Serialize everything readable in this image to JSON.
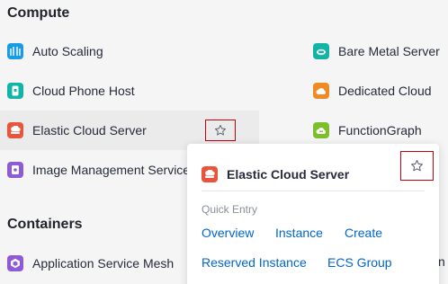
{
  "sections": {
    "compute": "Compute",
    "containers": "Containers"
  },
  "services": {
    "auto_scaling": "Auto Scaling",
    "bare_metal_server": "Bare Metal Server",
    "cloud_phone_host": "Cloud Phone Host",
    "dedicated_cloud": "Dedicated Cloud",
    "elastic_cloud_server": "Elastic Cloud Server",
    "function_graph": "FunctionGraph",
    "image_management_service": "Image Management Service",
    "application_service_mesh": "Application Service Mesh"
  },
  "popup": {
    "title": "Elastic Cloud Server",
    "quick_entry_label": "Quick Entry",
    "links": [
      "Overview",
      "Instance",
      "Create",
      "Reserved Instance",
      "ECS Group"
    ]
  },
  "clipped_text": "n",
  "colors": {
    "icon_blue": "#1a9be6",
    "icon_teal": "#12b5a5",
    "icon_orange": "#f08a24",
    "icon_red": "#e8553a",
    "icon_green": "#7cbf2a",
    "icon_purple": "#8e5ad6",
    "link": "#0066cc",
    "highlight_border": "#c7000b"
  },
  "icons": {
    "auto_scaling": "auto-scaling-icon",
    "bare_metal_server": "bare-metal-server-icon",
    "cloud_phone_host": "cloud-phone-host-icon",
    "dedicated_cloud": "dedicated-cloud-icon",
    "elastic_cloud_server": "elastic-cloud-server-icon",
    "function_graph": "function-graph-icon",
    "image_management_service": "image-management-service-icon",
    "application_service_mesh": "application-service-mesh-icon",
    "favorite": "star-icon"
  }
}
